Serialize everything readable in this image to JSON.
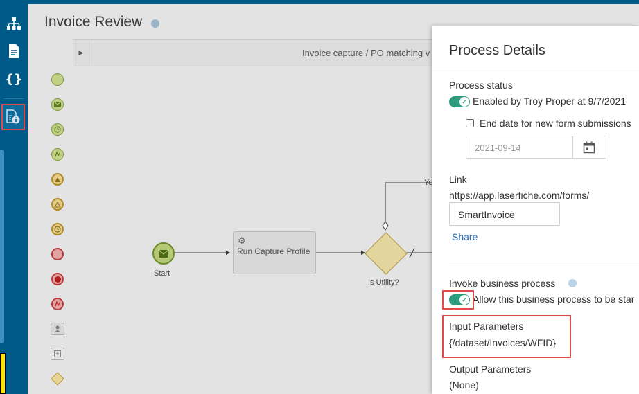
{
  "sidebar": {
    "items": [
      {
        "icon": "process-diagram-icon"
      },
      {
        "icon": "form-document-icon"
      },
      {
        "icon": "variables-braces-icon"
      },
      {
        "icon": "process-info-icon",
        "highlighted": true
      }
    ]
  },
  "header": {
    "title": "Invoice Review"
  },
  "subbar": {
    "text": "Invoice capture / PO matching v"
  },
  "palette": [
    "start-event",
    "message-start-event",
    "timer-start-event",
    "signal-start-event",
    "escalation-intermediate-event",
    "escalation-event",
    "timer-intermediate-event",
    "end-event",
    "terminate-end-event",
    "error-end-event",
    "user-task",
    "subprocess",
    "gateway"
  ],
  "diagram": {
    "start_label": "Start",
    "task_label": "Run Capture Profile",
    "gateway_label": "Is Utility?",
    "branch_label": "Ye"
  },
  "panel": {
    "title": "Process Details",
    "process_status": {
      "label": "Process status",
      "enabled": true,
      "enabled_text": "Enabled by Troy Proper at 9/7/2021",
      "end_date_checked": false,
      "end_date_text": "End date for new form submissions",
      "date_placeholder": "2021-09-14"
    },
    "link": {
      "label": "Link",
      "url": "https://app.laserfiche.com/forms/",
      "value": "SmartInvoice",
      "share": "Share"
    },
    "invoke": {
      "label": "Invoke business process",
      "enabled": true,
      "allow_text": "Allow this business process to be star"
    },
    "input_params": {
      "label": "Input Parameters",
      "value": "{/dataset/Invoices/WFID}"
    },
    "output_params": {
      "label": "Output Parameters",
      "value": "(None)"
    }
  },
  "colors": {
    "sidebar_bg": "#005a87",
    "toggle_on": "#2e9a7e",
    "highlight": "#e04a4a",
    "link": "#2a6db5"
  }
}
